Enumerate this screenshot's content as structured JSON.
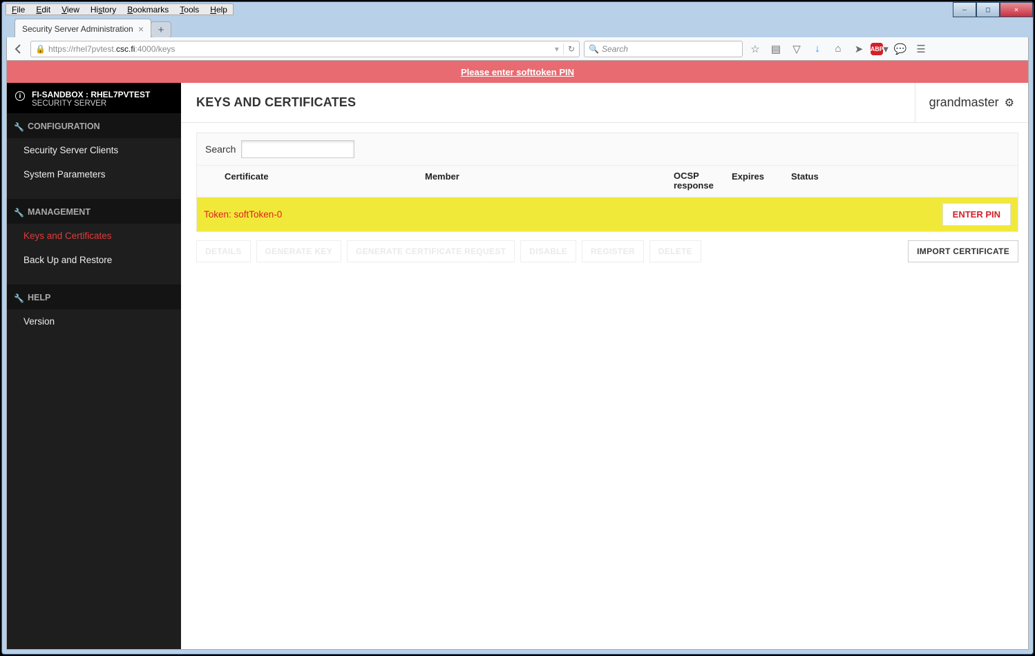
{
  "window": {
    "menu": [
      "File",
      "Edit",
      "View",
      "History",
      "Bookmarks",
      "Tools",
      "Help"
    ],
    "tab_title": "Security Server Administration",
    "url_prefix": "https://",
    "url_host_dim": "rhel7pvtest.",
    "url_host": "csc.fi",
    "url_port_path": ":4000/keys",
    "search_placeholder": "Search"
  },
  "banner": {
    "text": "Please enter softtoken PIN"
  },
  "sidebar": {
    "head_line1": "FI-SANDBOX : RHEL7PVTEST",
    "head_line2": "SECURITY SERVER",
    "sections": [
      {
        "title": "CONFIGURATION",
        "items": [
          "Security Server Clients",
          "System Parameters"
        ]
      },
      {
        "title": "MANAGEMENT",
        "items": [
          "Keys and Certificates",
          "Back Up and Restore"
        ],
        "active": "Keys and Certificates"
      },
      {
        "title": "HELP",
        "items": [
          "Version"
        ]
      }
    ]
  },
  "main": {
    "title": "KEYS AND CERTIFICATES",
    "user": "grandmaster",
    "search_label": "Search",
    "columns": {
      "cert": "Certificate",
      "member": "Member",
      "ocsp": "OCSP response",
      "expires": "Expires",
      "status": "Status"
    },
    "token_row": {
      "label": "Token: softToken-0",
      "button": "ENTER PIN"
    },
    "action_buttons_disabled": [
      "DETAILS",
      "GENERATE KEY",
      "GENERATE CERTIFICATE REQUEST",
      "DISABLE",
      "REGISTER",
      "DELETE"
    ],
    "import_button": "IMPORT CERTIFICATE"
  }
}
